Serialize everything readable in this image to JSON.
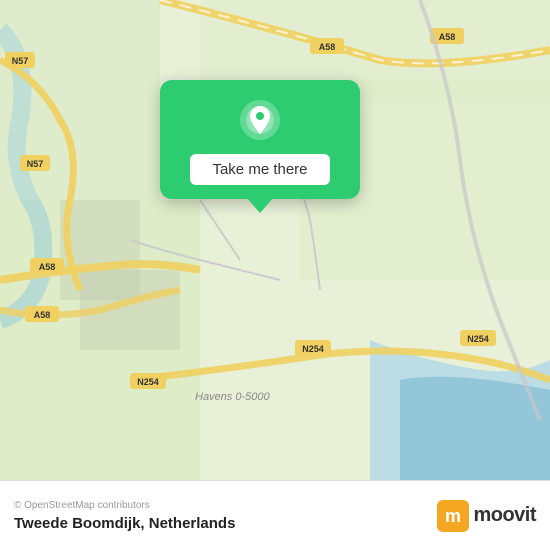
{
  "map": {
    "attribution": "© OpenStreetMap contributors",
    "bg_color": "#e8f0d8"
  },
  "popup": {
    "button_label": "Take me there",
    "pin_color": "#ffffff"
  },
  "footer": {
    "attribution": "© OpenStreetMap contributors",
    "location_name": "Tweede Boomdijk, Netherlands",
    "moovit_label": "moovit"
  },
  "roads": [
    {
      "label": "N57",
      "color": "#f5e642"
    },
    {
      "label": "A58",
      "color": "#f5e642"
    },
    {
      "label": "N254",
      "color": "#f5e642"
    },
    {
      "label": "Havens 0-5000",
      "color": "#aaa"
    }
  ]
}
